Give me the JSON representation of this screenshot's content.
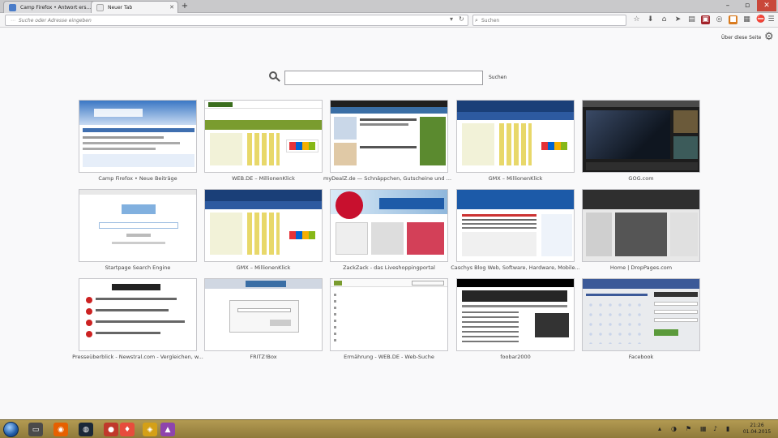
{
  "tabs": [
    {
      "label": "Camp Firefox • Antwort ers...",
      "active": false
    },
    {
      "label": "Neuer Tab",
      "active": true
    }
  ],
  "urlbar": {
    "placeholder": "Suche oder Adresse eingeben"
  },
  "searchbar": {
    "placeholder": "Suchen"
  },
  "page": {
    "about_label": "Über diese Seite",
    "search_button": "Suchen",
    "search_value": ""
  },
  "tiles": [
    {
      "title": "Camp Firefox • Neue Beiträge",
      "theme": "#1f4f91"
    },
    {
      "title": "WEB.DE – MillionenKlick",
      "theme": "#7a9c2f"
    },
    {
      "title": "myDealZ.de — Schnäppchen, Gutscheine und An...",
      "theme": "#3a6ea5"
    },
    {
      "title": "GMX – MillionenKlick",
      "theme": "#1a3f78"
    },
    {
      "title": "GOG.com",
      "theme": "#2a2a2a"
    },
    {
      "title": "Startpage Search Engine",
      "theme": "#e8e8e8"
    },
    {
      "title": "GMX – MillionenKlick",
      "theme": "#1a3f78"
    },
    {
      "title": "ZackZack - das Liveshoppingportal",
      "theme": "#c8102e"
    },
    {
      "title": "Caschys Blog Web, Software, Hardware, Mobile...",
      "theme": "#1c5aa8"
    },
    {
      "title": "Home | DropPages.com",
      "theme": "#3b3b3b"
    },
    {
      "title": "Presseüberblick - Newstral.com - Vergleichen, w...",
      "theme": "#ffffff"
    },
    {
      "title": "FRITZ!Box",
      "theme": "#d0d7e2"
    },
    {
      "title": "Ermährung - WEB.DE - Web-Suche",
      "theme": "#ffffff"
    },
    {
      "title": "foobar2000",
      "theme": "#ffffff"
    },
    {
      "title": "Facebook",
      "theme": "#3b5998"
    }
  ],
  "taskbar": {
    "clock_time": "21:26",
    "clock_date": "01.04.2015"
  }
}
